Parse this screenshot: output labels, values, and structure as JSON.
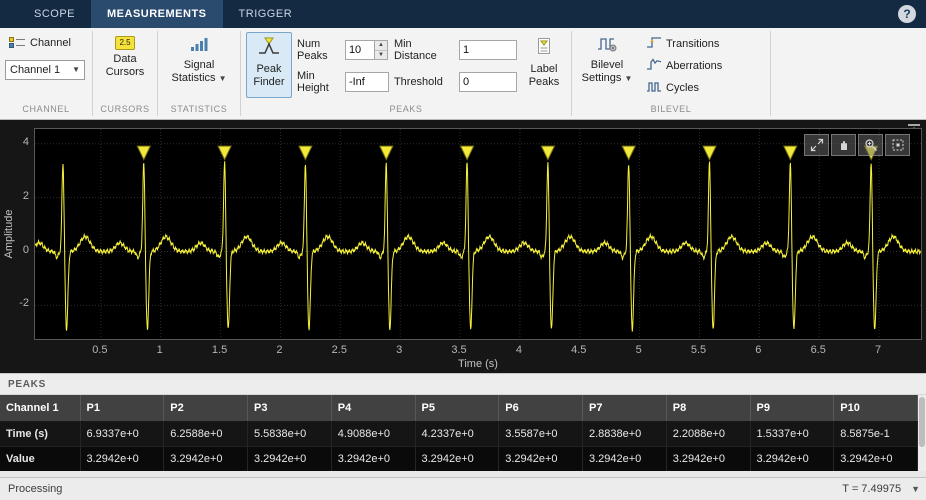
{
  "tabs": {
    "scope": "SCOPE",
    "measurements": "MEASUREMENTS",
    "trigger": "TRIGGER"
  },
  "help": {
    "label": "?"
  },
  "toolstrip": {
    "channel": {
      "button": "Channel",
      "dropdown_value": "Channel 1",
      "section": "CHANNEL"
    },
    "cursors": {
      "button": "Data Cursors",
      "badge": "2.5",
      "section": "CURSORS"
    },
    "statistics": {
      "button": "Signal Statistics",
      "section": "STATISTICS"
    },
    "peaks": {
      "peak_finder": "Peak Finder",
      "num_peaks_label": "Num Peaks",
      "num_peaks_value": "10",
      "min_height_label": "Min Height",
      "min_height_value": "-Inf",
      "min_distance_label": "Min Distance",
      "min_distance_value": "1",
      "threshold_label": "Threshold",
      "threshold_value": "0",
      "label_peaks": "Label Peaks",
      "section": "PEAKS"
    },
    "bilevel": {
      "settings": "Bilevel Settings",
      "transitions": "Transitions",
      "aberrations": "Aberrations",
      "cycles": "Cycles",
      "section": "BILEVEL"
    }
  },
  "chart_data": {
    "type": "line",
    "title": "",
    "xlabel": "Time (s)",
    "ylabel": "Amplitude",
    "xlim": [
      -0.05,
      7.35
    ],
    "ylim": [
      -3.25,
      4.55
    ],
    "x_ticks": [
      0.5,
      1,
      1.5,
      2,
      2.5,
      3,
      3.5,
      4,
      4.5,
      5,
      5.5,
      6,
      6.5,
      7
    ],
    "y_ticks": [
      -2,
      0,
      2,
      4
    ],
    "grid": true,
    "background": "#000000",
    "series": [
      {
        "name": "Channel 1",
        "color": "#f6f23a",
        "description": "ECG-like periodic waveform",
        "beat_period": 0.675,
        "first_beat_time": 0.18375,
        "beat_count": 11,
        "peak_value": 3.2942,
        "trough_value": -2.7
      }
    ],
    "peak_markers": {
      "times": [
        0.85875,
        1.53375,
        2.20875,
        2.88375,
        3.55875,
        4.23375,
        4.90875,
        5.58375,
        6.25875,
        6.93375
      ],
      "value": 3.2942,
      "marker": "triangle-down",
      "color": "#f2e93b"
    }
  },
  "peaks_panel": {
    "title": "PEAKS",
    "table": {
      "header": [
        "Channel 1",
        "P1",
        "P2",
        "P3",
        "P4",
        "P5",
        "P6",
        "P7",
        "P8",
        "P9",
        "P10"
      ],
      "rows": [
        {
          "label": "Time (s)",
          "values": [
            "6.9337e+0",
            "6.2588e+0",
            "5.5838e+0",
            "4.9088e+0",
            "4.2337e+0",
            "3.5587e+0",
            "2.8838e+0",
            "2.2088e+0",
            "1.5337e+0",
            "8.5875e-1"
          ]
        },
        {
          "label": "Value",
          "values": [
            "3.2942e+0",
            "3.2942e+0",
            "3.2942e+0",
            "3.2942e+0",
            "3.2942e+0",
            "3.2942e+0",
            "3.2942e+0",
            "3.2942e+0",
            "3.2942e+0",
            "3.2942e+0"
          ]
        }
      ]
    }
  },
  "status": {
    "left": "Processing",
    "right": "T = 7.49975"
  }
}
